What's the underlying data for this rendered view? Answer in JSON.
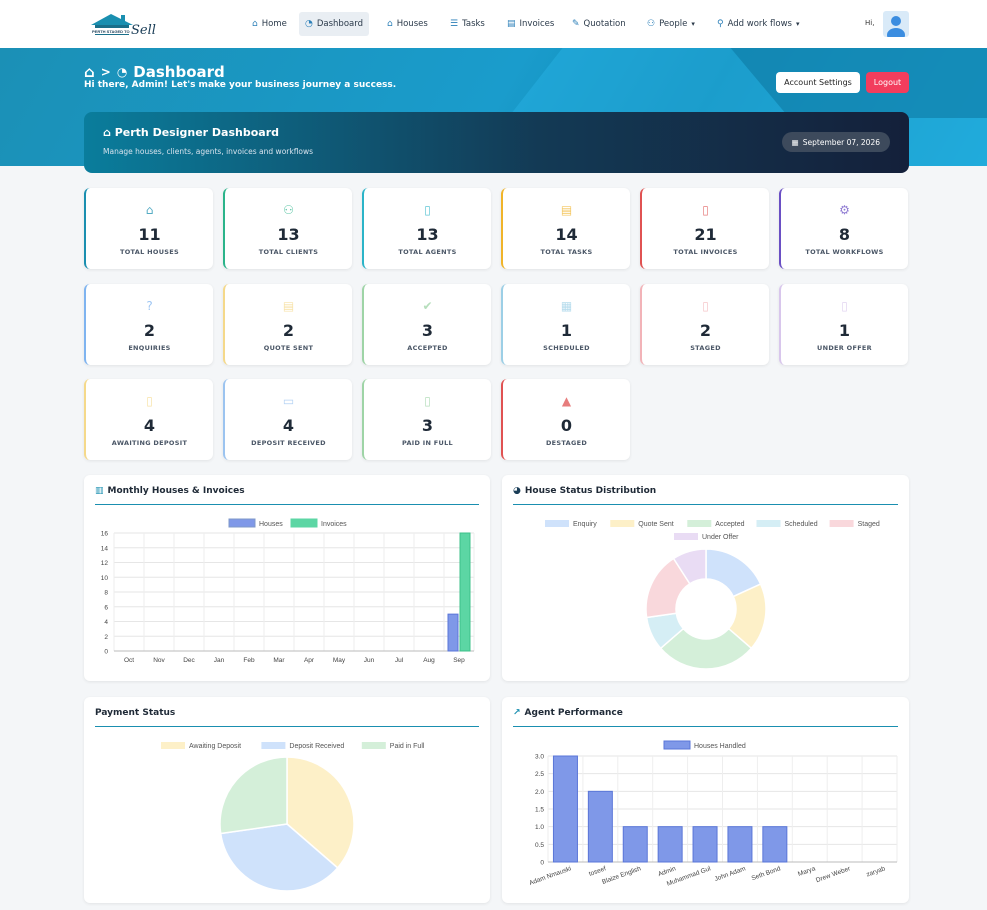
{
  "nav": {
    "logo_text": "PERTH STAGED TO Sell",
    "items": [
      {
        "label": "Home",
        "icon": "home-icon"
      },
      {
        "label": "Dashboard",
        "icon": "dashboard-icon"
      },
      {
        "label": "Houses",
        "icon": "house-icon"
      },
      {
        "label": "Tasks",
        "icon": "tasks-icon"
      },
      {
        "label": "Invoices",
        "icon": "invoice-icon"
      },
      {
        "label": "Quotation",
        "icon": "quotation-icon"
      },
      {
        "label": "People",
        "icon": "people-icon"
      },
      {
        "label": "Add work flows",
        "icon": "workflow-icon"
      }
    ],
    "greeting": "Hi,"
  },
  "header": {
    "title": "Dashboard",
    "welcome": "Hi there, Admin! Let's make your business journey a success.",
    "account_settings": "Account Settings",
    "logout": "Logout"
  },
  "banner": {
    "title": "Perth Designer Dashboard",
    "subtitle": "Manage houses, clients, agents, invoices and workflows",
    "date": "September 07, 2026"
  },
  "stats_row1": [
    {
      "value": "11",
      "label": "TOTAL HOUSES",
      "color": "#1a8fb0",
      "icon": "home-icon"
    },
    {
      "value": "13",
      "label": "TOTAL CLIENTS",
      "color": "#2bb48a",
      "icon": "users-icon"
    },
    {
      "value": "13",
      "label": "TOTAL AGENTS",
      "color": "#2bb4c8",
      "icon": "agent-icon"
    },
    {
      "value": "14",
      "label": "TOTAL TASKS",
      "color": "#f0b429",
      "icon": "tasks-icon"
    },
    {
      "value": "21",
      "label": "TOTAL INVOICES",
      "color": "#e05252",
      "icon": "invoice-icon"
    },
    {
      "value": "8",
      "label": "TOTAL WORKFLOWS",
      "color": "#6a4fc4",
      "icon": "cogs-icon"
    }
  ],
  "stats_row2": [
    {
      "value": "2",
      "label": "ENQUIRIES",
      "color": "#7fb4f0",
      "icon": "question-icon"
    },
    {
      "value": "2",
      "label": "QUOTE SENT",
      "color": "#f5d98a",
      "icon": "file-icon"
    },
    {
      "value": "3",
      "label": "ACCEPTED",
      "color": "#9ed4a6",
      "icon": "check-circle-icon"
    },
    {
      "value": "1",
      "label": "SCHEDULED",
      "color": "#9ccfe6",
      "icon": "calendar-icon"
    },
    {
      "value": "2",
      "label": "STAGED",
      "color": "#f2b3b8",
      "icon": "staged-icon"
    },
    {
      "value": "1",
      "label": "UNDER OFFER",
      "color": "#d8c6ec",
      "icon": "offer-icon"
    }
  ],
  "stats_row3": [
    {
      "value": "4",
      "label": "AWAITING DEPOSIT",
      "color": "#f5d98a",
      "icon": "hourglass-icon"
    },
    {
      "value": "4",
      "label": "DEPOSIT RECEIVED",
      "color": "#9cc4f0",
      "icon": "credit-card-icon"
    },
    {
      "value": "3",
      "label": "PAID IN FULL",
      "color": "#9ed4a6",
      "icon": "paid-icon"
    },
    {
      "value": "0",
      "label": "DESTAGED",
      "color": "#e05252",
      "icon": "warning-icon"
    }
  ],
  "panels": {
    "monthly": "Monthly Houses & Invoices",
    "status": "House Status Distribution",
    "payment": "Payment Status",
    "agent": "Agent Performance"
  },
  "chart_data": [
    {
      "type": "bar",
      "title": "Monthly Houses & Invoices",
      "categories": [
        "Oct",
        "Nov",
        "Dec",
        "Jan",
        "Feb",
        "Mar",
        "Apr",
        "May",
        "Jun",
        "Jul",
        "Aug",
        "Sep"
      ],
      "series": [
        {
          "name": "Houses",
          "values": [
            0,
            0,
            0,
            0,
            0,
            0,
            0,
            0,
            0,
            0,
            0,
            5
          ],
          "color": "#7f98e8"
        },
        {
          "name": "Invoices",
          "values": [
            0,
            0,
            0,
            0,
            0,
            0,
            0,
            0,
            0,
            0,
            0,
            16
          ],
          "color": "#5cd6a4"
        }
      ],
      "ylim": [
        0,
        16
      ],
      "yticks": [
        0,
        2,
        4,
        6,
        8,
        10,
        12,
        14,
        16
      ],
      "legend": "top"
    },
    {
      "type": "pie",
      "title": "House Status Distribution",
      "donut": true,
      "categories": [
        "Enquiry",
        "Quote Sent",
        "Accepted",
        "Scheduled",
        "Staged",
        "Under Offer"
      ],
      "values": [
        2,
        2,
        3,
        1,
        2,
        1
      ],
      "colors": [
        "#cfe2fb",
        "#fdf0c8",
        "#d4efd9",
        "#d5eef5",
        "#f9d8dc",
        "#e9dcf4"
      ],
      "legend": "top"
    },
    {
      "type": "pie",
      "title": "Payment Status",
      "categories": [
        "Awaiting Deposit",
        "Deposit Received",
        "Paid in Full"
      ],
      "values": [
        4,
        4,
        3
      ],
      "colors": [
        "#fdf0c8",
        "#cfe2fb",
        "#d4efd9"
      ],
      "legend": "top"
    },
    {
      "type": "bar",
      "title": "Agent Performance",
      "categories": [
        "Adam Nmauski",
        "toseef",
        "Blaize English",
        "Admin",
        "Muhammad Gul",
        "John Adam",
        "Seth Bond",
        "Marya",
        "Drew Weber",
        "zaryab"
      ],
      "series": [
        {
          "name": "Houses Handled",
          "values": [
            3,
            2,
            1,
            1,
            1,
            1,
            1,
            0,
            0,
            0
          ],
          "color": "#7f98e8"
        }
      ],
      "ylim": [
        0,
        3
      ],
      "yticks": [
        "0",
        "0.5",
        "1.0",
        "1.5",
        "2.0",
        "2.5",
        "3.0"
      ],
      "legend": "top"
    }
  ]
}
